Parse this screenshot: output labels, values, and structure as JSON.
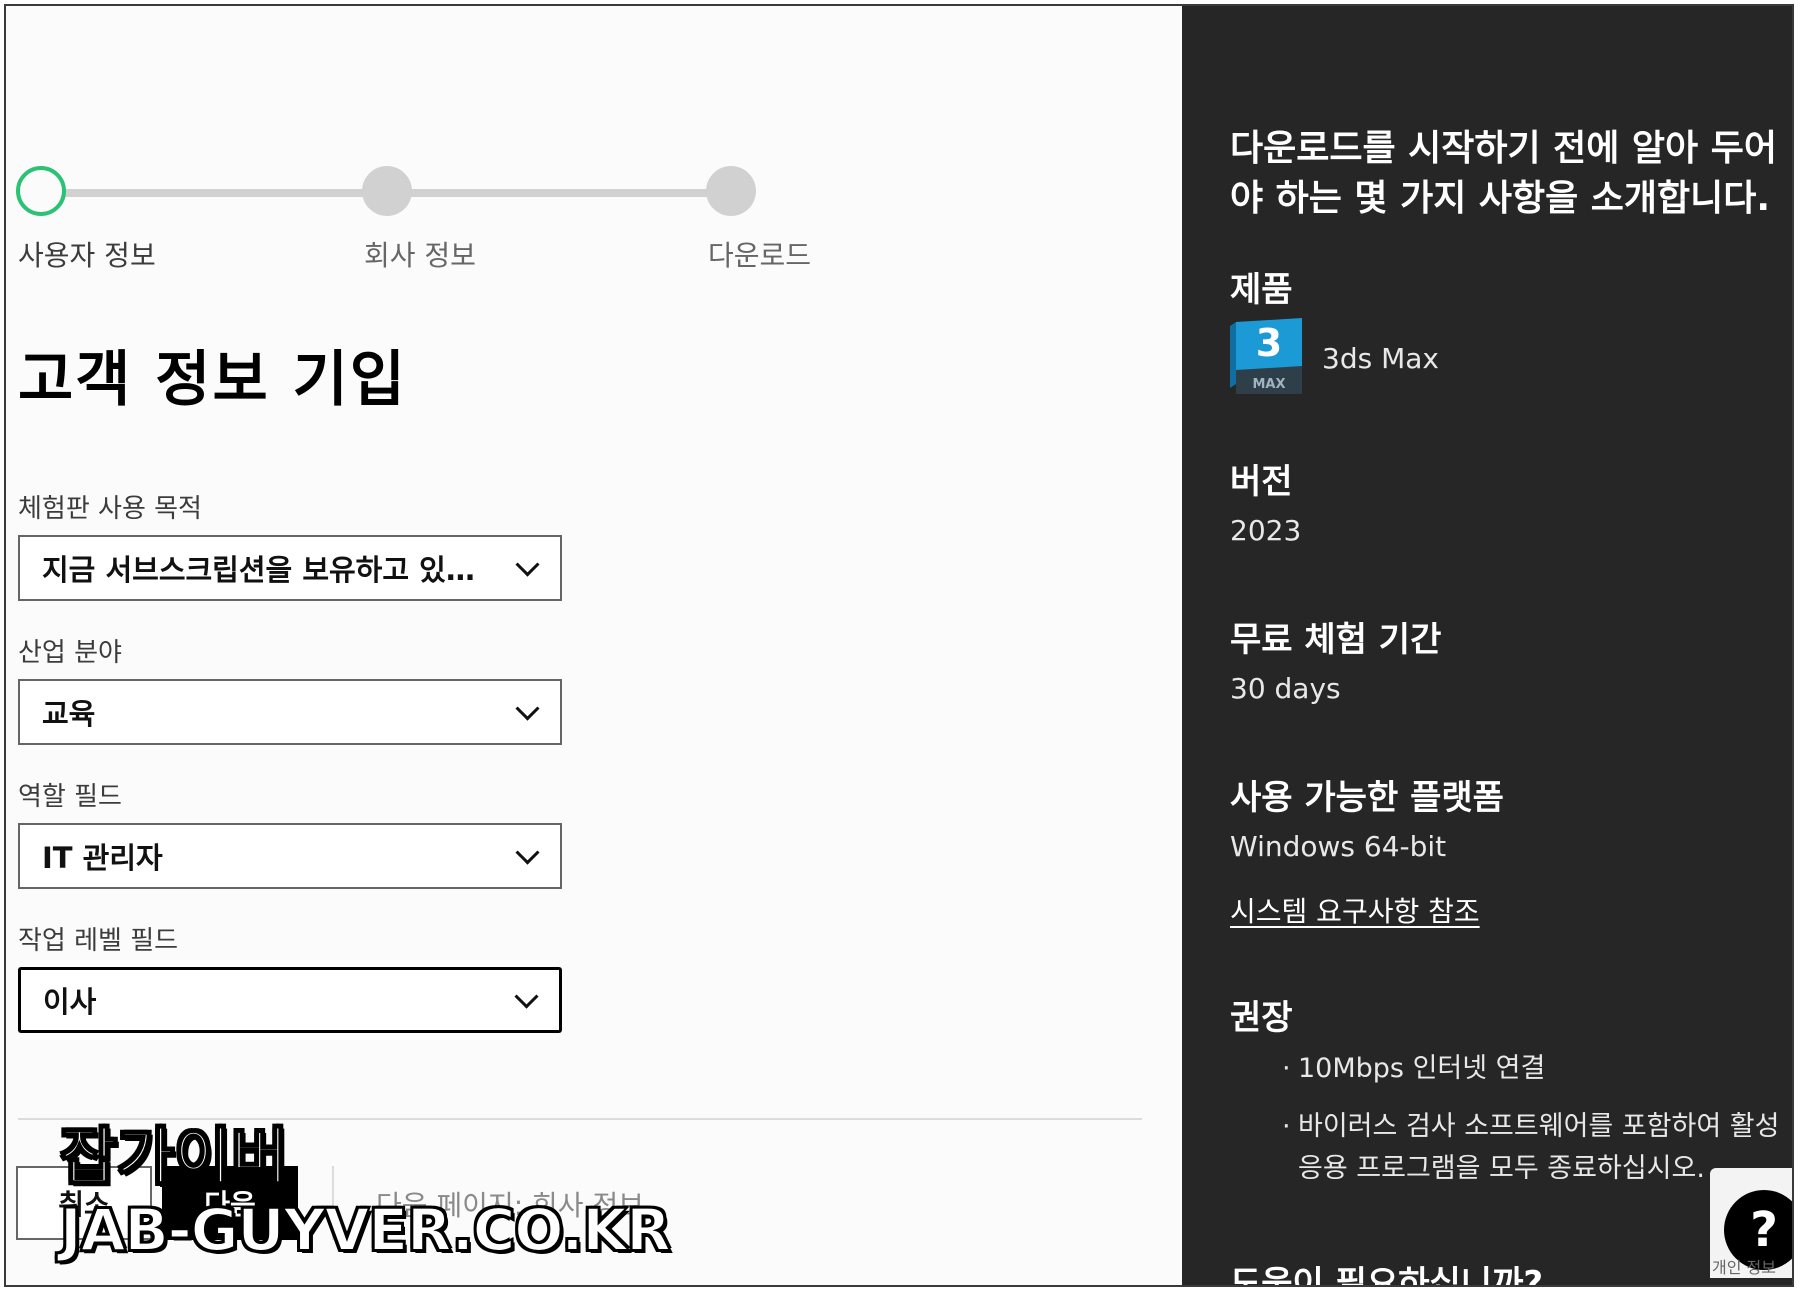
{
  "stepper": {
    "steps": [
      {
        "label": "사용자 정보",
        "state": "current"
      },
      {
        "label": "회사 정보",
        "state": "pending"
      },
      {
        "label": "다운로드",
        "state": "pending"
      }
    ],
    "active_color": "#2bc275"
  },
  "form": {
    "title": "고객 정보 기입",
    "fields": [
      {
        "label": "체험판 사용 목적",
        "value": "지금 서브스크립션을 보유하고 있으며 이 제품을 평가합니다"
      },
      {
        "label": "산업 분야",
        "value": "교육"
      },
      {
        "label": "역할 필드",
        "value": "IT 관리자"
      },
      {
        "label": "작업 레벨 필드",
        "value": "이사"
      }
    ]
  },
  "footer": {
    "cancel_label": "취소",
    "next_label": "다음",
    "next_page_hint": "다음 페이지:  회사 정보"
  },
  "watermark": {
    "line1": "잡가이버",
    "line2": "JAB-GUYVER.CO.KR"
  },
  "info": {
    "intro": "다운로드를 시작하기 전에 알아 두어야 하는 몇 가지 사항을 소개합니다.",
    "product_heading": "제품",
    "product_icon": "3ds-max-logo",
    "product_logo_text": "3",
    "product_logo_subtext": "MAX",
    "product_name": "3ds Max",
    "version_heading": "버전",
    "version_value": "2023",
    "trial_heading": "무료 체험 기간",
    "trial_value": "30 days",
    "platform_heading": "사용 가능한 플랫폼",
    "platform_value": "Windows 64-bit",
    "sysreq_link": "시스템 요구사항 참조",
    "recommend_heading": "권장",
    "recommendations": [
      "10Mbps 인터넷 연결",
      "바이러스 검사 소프트웨어를 포함하여 활성 응용 프로그램을 모두 종료하십시오."
    ],
    "help_heading": "도움이 필요하십니까?"
  },
  "help_widget": {
    "symbol": "?",
    "caption": "개인 정보"
  },
  "colors": {
    "panel_bg": "#262626",
    "left_bg": "#fbfbfb",
    "logo_blue": "#1b9ad6"
  }
}
